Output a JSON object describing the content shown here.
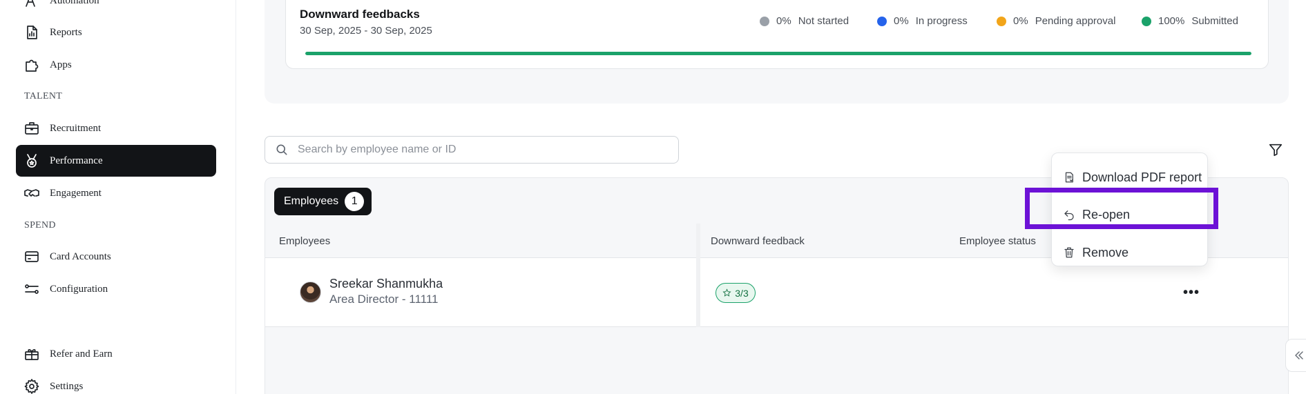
{
  "sidebar": {
    "items": [
      {
        "label": "Automation",
        "icon": "automation-icon"
      },
      {
        "label": "Reports",
        "icon": "reports-icon"
      },
      {
        "label": "Apps",
        "icon": "puzzle-icon"
      },
      {
        "label": "Recruitment",
        "icon": "briefcase-icon"
      },
      {
        "label": "Performance",
        "icon": "medal-icon",
        "active": true
      },
      {
        "label": "Engagement",
        "icon": "handshake-icon"
      },
      {
        "label": "Card Accounts",
        "icon": "credit-card-icon"
      },
      {
        "label": "Configuration",
        "icon": "sliders-icon"
      },
      {
        "label": "Refer and Earn",
        "icon": "gift-icon"
      },
      {
        "label": "Settings",
        "icon": "gear-icon"
      }
    ],
    "sections": {
      "talent": "TALENT",
      "spend": "SPEND"
    }
  },
  "summary": {
    "title": "Downward feedbacks",
    "date_range": "30 Sep, 2025 - 30 Sep, 2025",
    "legend": [
      {
        "pct": "0%",
        "label": "Not started",
        "color": "#9aa0a8"
      },
      {
        "pct": "0%",
        "label": "In progress",
        "color": "#2563eb"
      },
      {
        "pct": "0%",
        "label": "Pending approval",
        "color": "#f2a51a"
      },
      {
        "pct": "100%",
        "label": "Submitted",
        "color": "#1ba26a"
      }
    ],
    "progress_percent": 100
  },
  "search": {
    "placeholder": "Search by employee name or ID"
  },
  "tabs": {
    "employees_label": "Employees",
    "employees_count": "1"
  },
  "table": {
    "headers": {
      "employees": "Employees",
      "downward_feedback": "Downward feedback",
      "employee_status": "Employee status"
    },
    "rows": [
      {
        "name": "Sreekar Shanmukha",
        "role": "Area Director - 11111",
        "score": "3/3"
      }
    ]
  },
  "menu": {
    "items": [
      {
        "label": "Download PDF report",
        "icon": "pdf-report-icon"
      },
      {
        "label": "Re-open",
        "icon": "undo-icon"
      },
      {
        "label": "Remove",
        "icon": "trash-icon"
      }
    ]
  },
  "colors": {
    "accent": "#121417",
    "success": "#1ba26a",
    "highlight": "#6c12d6"
  }
}
